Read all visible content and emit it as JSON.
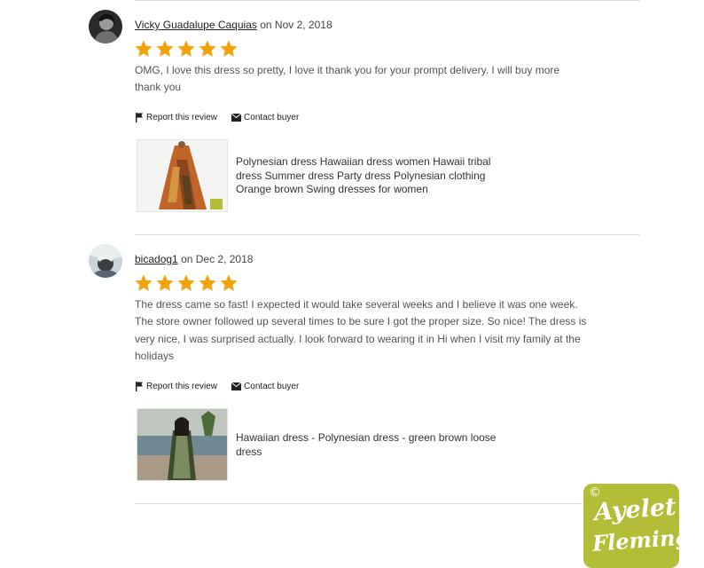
{
  "reviews": [
    {
      "reviewer": "Vicky Guadalupe Caquias",
      "date": "on Nov 2, 2018",
      "rating": 5,
      "text": "OMG, I love this dress so pretty, I love it thank you for your prompt delivery. I will buy more thank you",
      "report_label": "Report this review",
      "contact_label": "Contact buyer",
      "product_title": "Polynesian dress Hawaiian dress women Hawaii tribal dress Summer dress Party dress Polynesian clothing Orange brown Swing dresses for women"
    },
    {
      "reviewer": "bicadog1",
      "date": "on Dec 2, 2018",
      "rating": 5,
      "text": "The dress came so fast! I expected it would take several weeks and I believe it was one week. The store owner followed up several times to be sure I got the proper size. So nice! The dress is very nice, I was surprised actually. I look forward to wearing it in Hi when I visit my family at the holidays",
      "report_label": "Report this review",
      "contact_label": "Contact buyer",
      "product_title": "Hawaiian dress - Polynesian dress - green brown loose dress"
    }
  ],
  "watermark": {
    "copyright": "©",
    "line1": "Ayelet",
    "line2": "Fleming"
  },
  "colors": {
    "star": "#f1a30e",
    "divider": "#dcdcdc",
    "watermark_bg": "#b3bd38"
  },
  "icons": {
    "report": "flag-icon",
    "contact": "envelope-icon",
    "rating": "star-icon"
  }
}
